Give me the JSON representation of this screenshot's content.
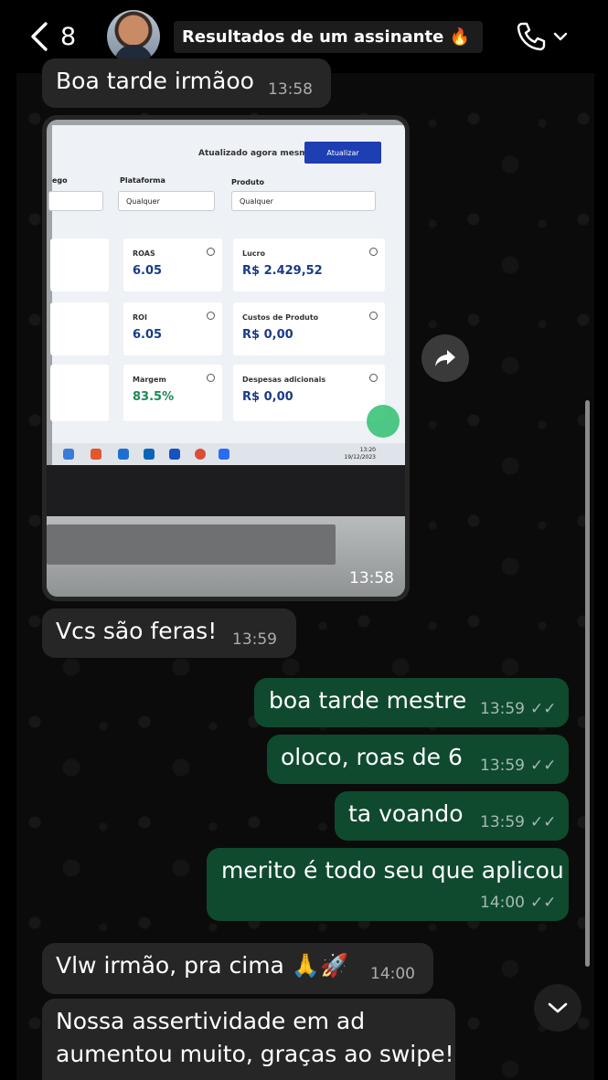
{
  "header": {
    "back_count": "8",
    "chat_title": "Resultados de um assinante 🔥"
  },
  "messages": {
    "m1": {
      "text": "Boa tarde irmãoo",
      "time": "13:58"
    },
    "m2": {
      "time": "13:58"
    },
    "m3": {
      "text": "Vcs são feras!",
      "time": "13:59"
    },
    "m4": {
      "text": "boa tarde mestre",
      "time": "13:59"
    },
    "m5": {
      "text": "oloco, roas de 6",
      "time": "13:59"
    },
    "m6": {
      "text": "ta voando",
      "time": "13:59"
    },
    "m7": {
      "text": "merito é todo seu que aplicou",
      "time": "14:00"
    },
    "m8": {
      "text": "Vlw irmão, pra cima 🙏🚀",
      "time": "14:00"
    },
    "m9": {
      "line1": "Nossa assertividade em ad",
      "line2": "aumentou muito, graças ao swipe!"
    }
  },
  "photo": {
    "updated_text": "Atualizado agora mesmo",
    "update_button": "Atualizar",
    "filters": {
      "f1_label": "ego",
      "platform_label": "Plataforma",
      "platform_value": "Qualquer",
      "product_label": "Produto",
      "product_value": "Qualquer"
    },
    "cards": {
      "roas_label": "ROAS",
      "roas_value": "6.05",
      "lucro_label": "Lucro",
      "lucro_value": "R$ 2.429,52",
      "roi_label": "ROI",
      "roi_value": "6.05",
      "custos_label": "Custos de Produto",
      "custos_value": "R$ 0,00",
      "margem_label": "Margem",
      "margem_value": "83.5%",
      "despesas_label": "Despesas adicionais",
      "despesas_value": "R$ 0,00"
    },
    "clock_time": "13:20",
    "clock_date": "19/12/2023"
  },
  "colors": {
    "incoming_bubble": "#262626",
    "outgoing_bubble": "#0f4a2e",
    "background": "#000000"
  },
  "icons": [
    "back-chevron-icon",
    "phone-icon",
    "chevron-down-icon",
    "forward-icon",
    "double-check-icon"
  ]
}
